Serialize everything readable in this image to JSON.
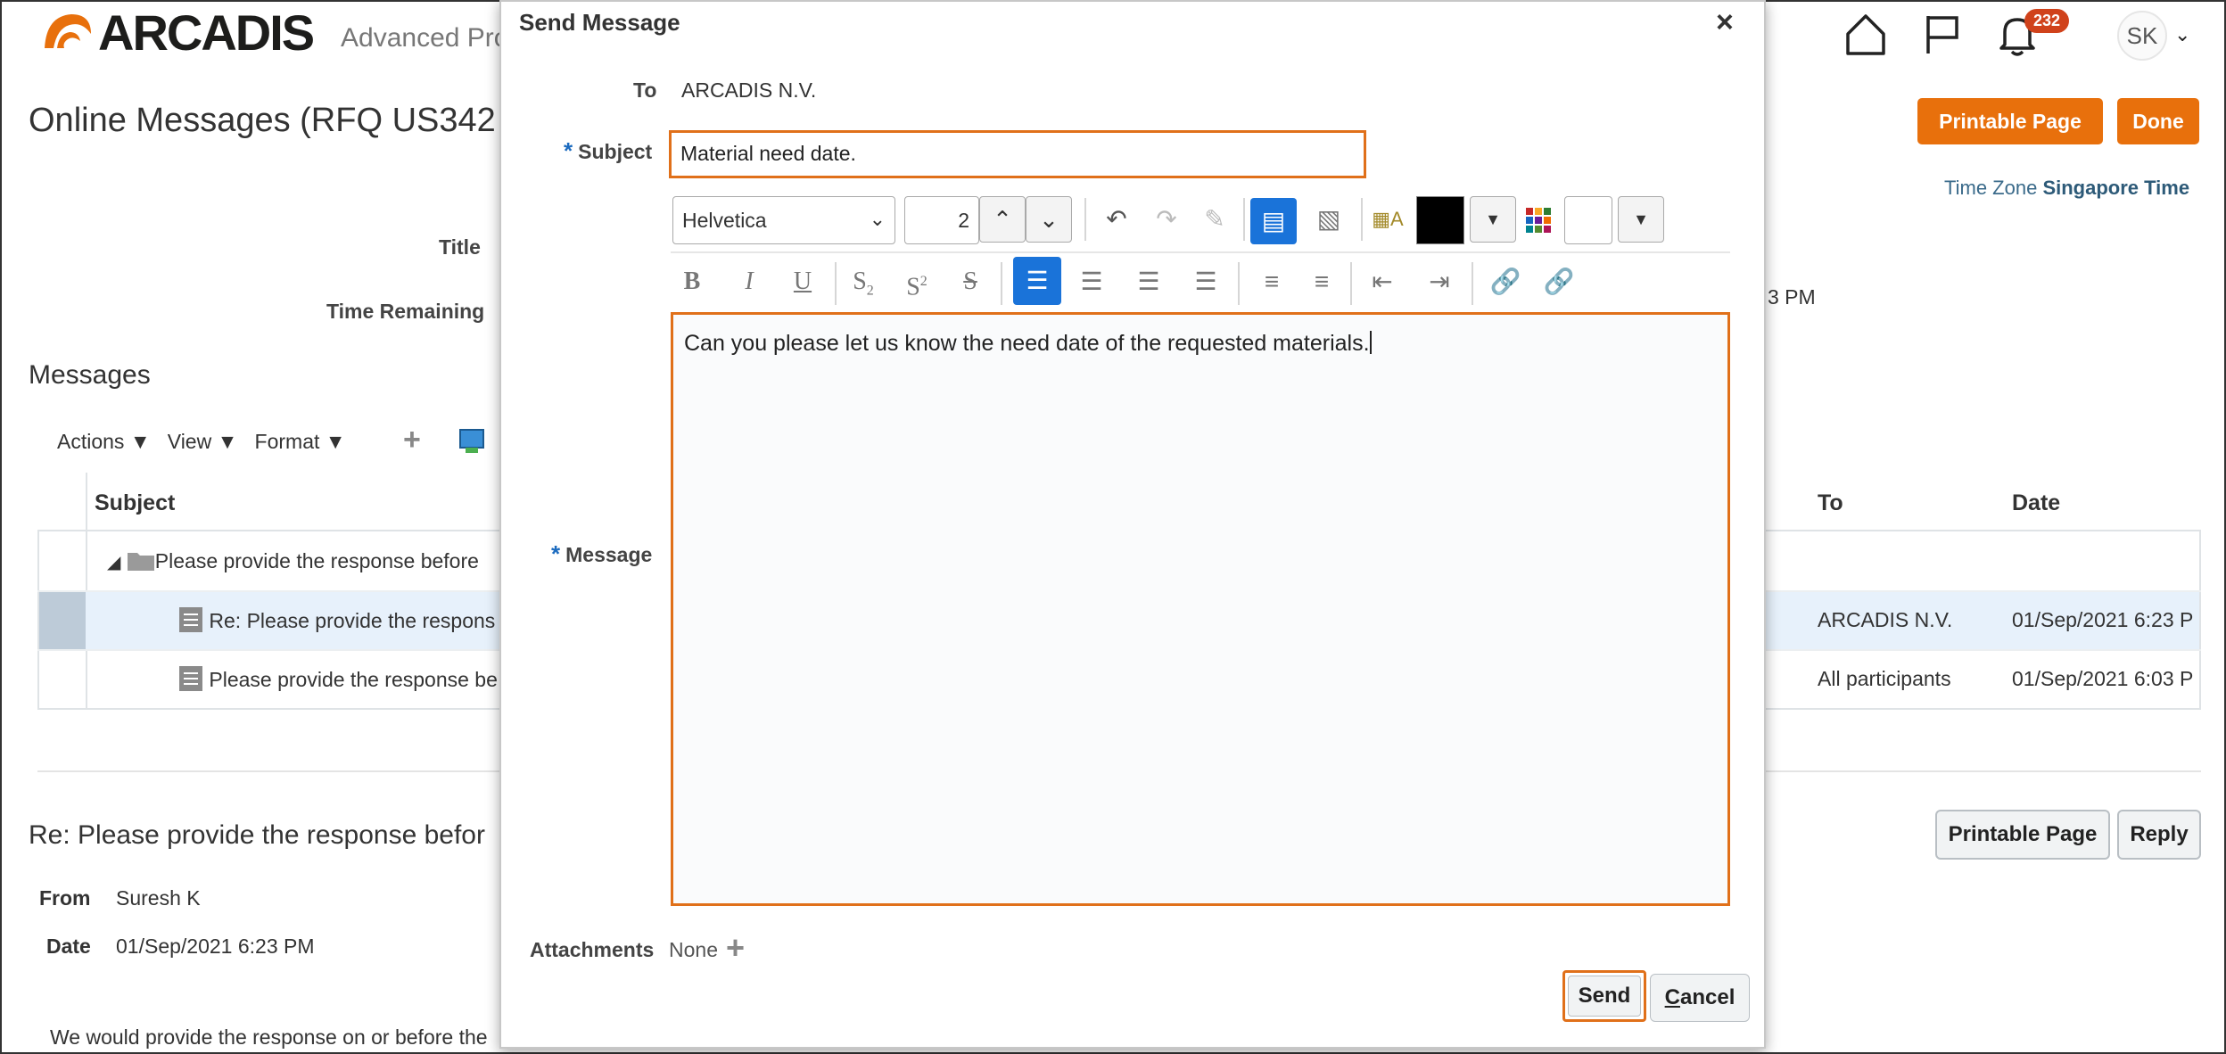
{
  "header": {
    "brand": "ARCADIS",
    "app_subtitle": "Advanced Pro",
    "notification_count": "232",
    "user_initials": "SK",
    "brand_color": "#e8700c"
  },
  "page": {
    "title": "Online Messages (RFQ US342",
    "printable_label": "Printable Page",
    "done_label": "Done",
    "timezone_label": "Time Zone",
    "timezone_value": "Singapore Time",
    "title_label": "Title",
    "time_remaining_label": "Time Remaining",
    "time_remaining_tail": "3 PM"
  },
  "messages_section": {
    "heading": "Messages",
    "toolbar": {
      "actions": "Actions",
      "view": "View",
      "format": "Format"
    },
    "columns": {
      "subject": "Subject",
      "to": "To",
      "date": "Date"
    },
    "rows": [
      {
        "subject": "Please provide the response before",
        "to": "",
        "date": ""
      },
      {
        "subject": "Re: Please provide the respons",
        "to": "ARCADIS N.V.",
        "date": "01/Sep/2021 6:23 P"
      },
      {
        "subject": "Please provide the response be",
        "to": "All participants",
        "date": "01/Sep/2021 6:03 P"
      }
    ]
  },
  "detail": {
    "heading": "Re: Please provide the response befor",
    "from_label": "From",
    "from_value": "Suresh K",
    "date_label": "Date",
    "date_value": "01/Sep/2021 6:23 PM",
    "body": "We would provide the response on or before the",
    "printable_label": "Printable Page",
    "reply_label": "Reply"
  },
  "dialog": {
    "title": "Send Message",
    "close_glyph": "×",
    "to_label": "To",
    "to_value": "ARCADIS N.V.",
    "required_mark": "*",
    "subject_label": "Subject",
    "subject_value": "Material need date.",
    "editor": {
      "font_family": "Helvetica",
      "font_size": "2",
      "message_label": "Message",
      "message_text": "Can you please let us know the need date of the requested materials."
    },
    "attachments_label": "Attachments",
    "attachments_value": "None",
    "send_label": "Send",
    "cancel_first": "C",
    "cancel_rest": "ancel",
    "highlight_color": "#e0701a"
  }
}
